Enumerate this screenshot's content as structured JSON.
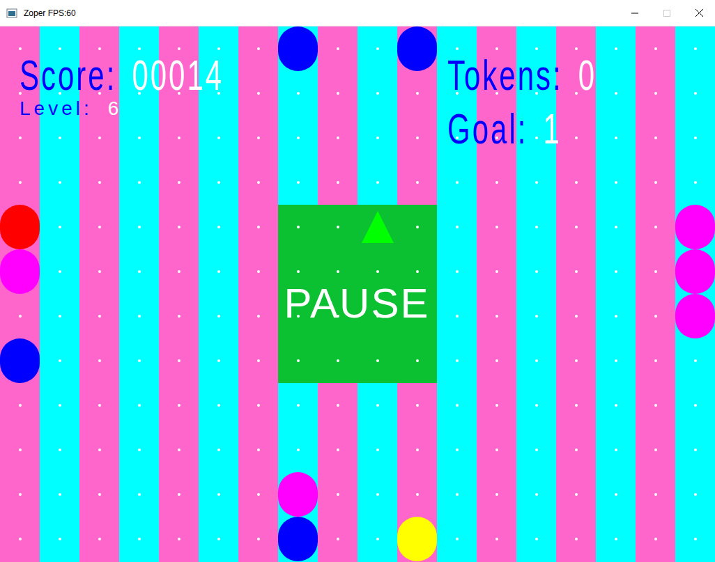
{
  "window": {
    "title": "Zoper FPS:60"
  },
  "hud": {
    "score": {
      "label": "Score:",
      "value": "00014"
    },
    "level": {
      "label": "Level:",
      "value": "6"
    },
    "tokens": {
      "label": "Tokens:",
      "value": "0"
    },
    "goal": {
      "label": "Goal:",
      "value": "1"
    }
  },
  "board": {
    "columns": 18,
    "rows": 12,
    "zone": {
      "col": 7,
      "row": 4,
      "width": 4,
      "height": 4
    },
    "pieces": [
      {
        "col": 7,
        "row": 0,
        "color": "#0000ff"
      },
      {
        "col": 10,
        "row": 0,
        "color": "#0000ff"
      },
      {
        "col": 0,
        "row": 4,
        "color": "#ff0000"
      },
      {
        "col": 0,
        "row": 5,
        "color": "#ff00ff"
      },
      {
        "col": 0,
        "row": 7,
        "color": "#0000ff"
      },
      {
        "col": 17,
        "row": 4,
        "color": "#ff00ff"
      },
      {
        "col": 17,
        "row": 5,
        "color": "#ff00ff"
      },
      {
        "col": 17,
        "row": 6,
        "color": "#ff00ff"
      },
      {
        "col": 7,
        "row": 10,
        "color": "#ff00ff"
      },
      {
        "col": 7,
        "row": 11,
        "color": "#0000ff"
      },
      {
        "col": 10,
        "row": 11,
        "color": "#ffff00"
      }
    ],
    "player": {
      "col": 9,
      "row": 4,
      "direction": "up",
      "color": "#00ff00"
    }
  },
  "overlay": {
    "text": "PAUSE"
  }
}
